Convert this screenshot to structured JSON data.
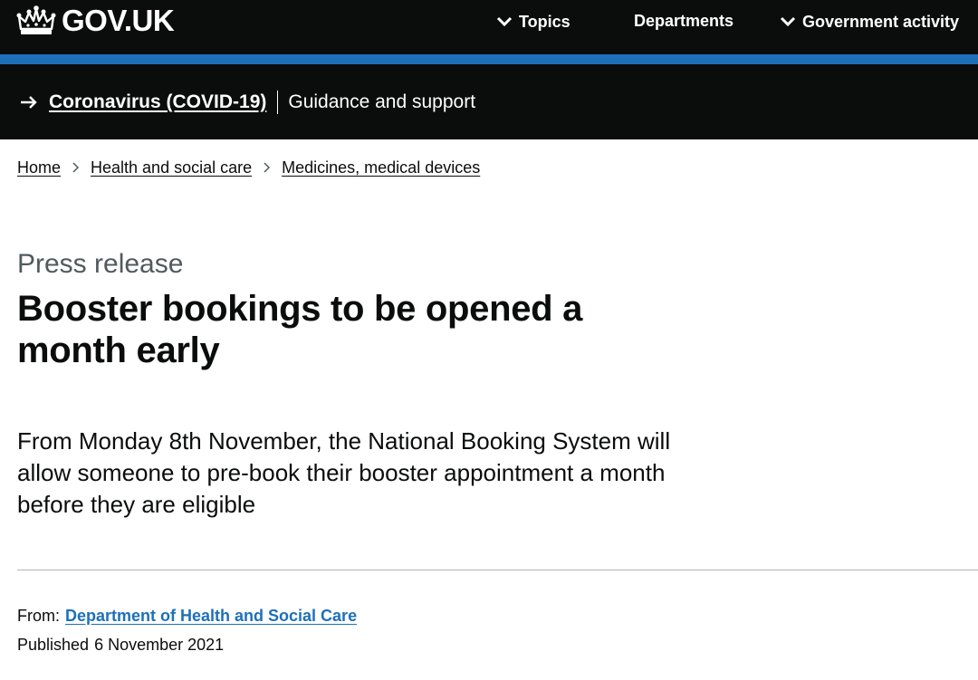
{
  "header": {
    "logo_text": "GOV.UK",
    "logo_icon": "crown-icon",
    "nav": [
      {
        "label": "Topics",
        "icon": "chevron-down-icon"
      },
      {
        "label": "Departments"
      },
      {
        "label": "Government activity",
        "icon": "chevron-down-icon"
      }
    ],
    "colors": {
      "header_bg": "#0b0c0c",
      "brand_blue": "#1d70b8"
    }
  },
  "covid_banner": {
    "icon": "arrow-right-icon",
    "link_label": "Coronavirus (COVID-19)",
    "sub_label": "Guidance and support"
  },
  "breadcrumb": {
    "items": [
      "Home",
      "Health and social care",
      "Medicines, medical devices"
    ],
    "separator_icon": "chevron-right-icon"
  },
  "article": {
    "caption": "Press release",
    "title": "Booster bookings to be opened a month early",
    "lede": "From Monday 8th November, the National Booking System will allow someone to pre-book their booster appointment a month before they are eligible"
  },
  "meta": {
    "from_label": "From:",
    "from_org": "Department of Health and Social Care",
    "published_label": "Published",
    "published_date": "6 November 2021"
  }
}
